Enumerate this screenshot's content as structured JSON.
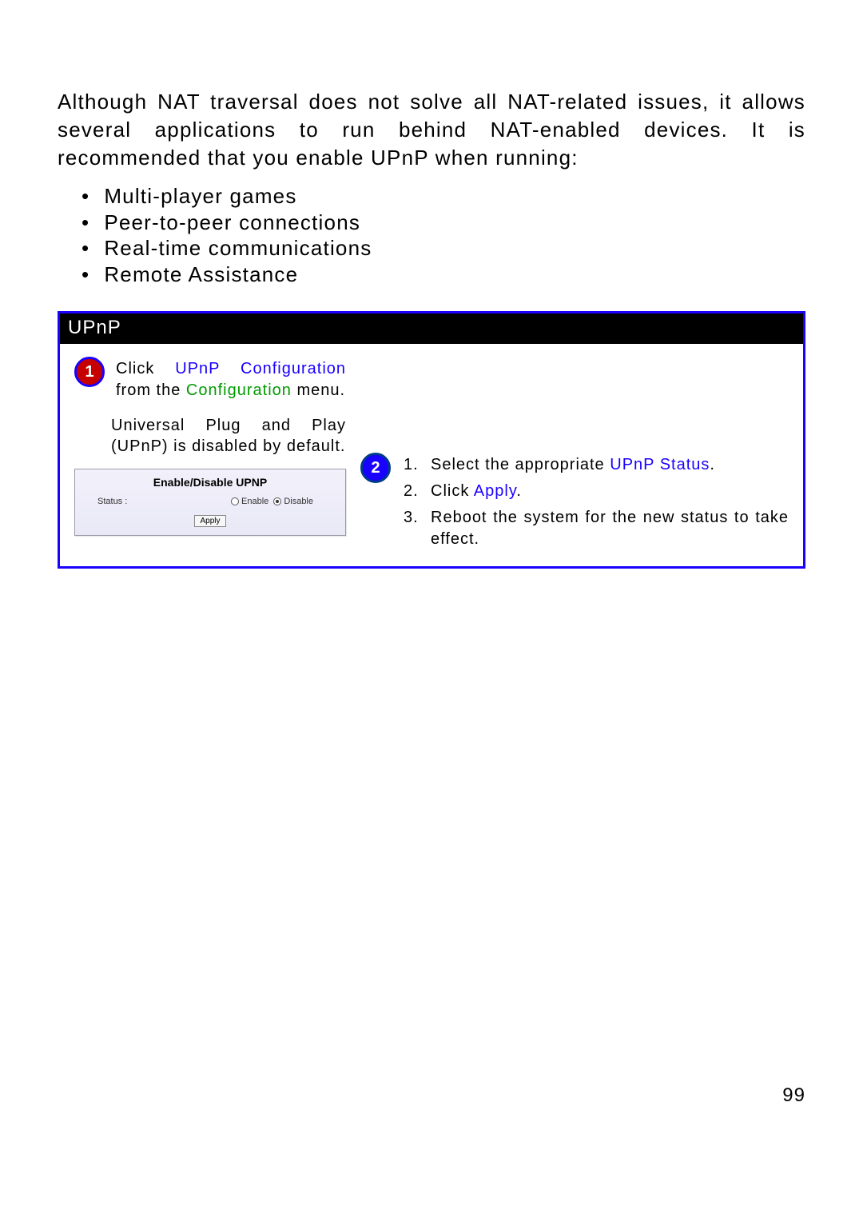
{
  "intro_text": "Although NAT traversal does not solve all NAT-related issues, it allows several applications to run behind NAT-enabled devices. It is recommended that you enable UPnP when running:",
  "bullets": [
    "Multi-player games",
    "Peer-to-peer connections",
    "Real-time communications",
    "Remote Assistance"
  ],
  "panel": {
    "title": "UPnP",
    "step1": {
      "number": "1",
      "pre": "Click ",
      "link": "UPnP Configuration",
      "mid": " from the ",
      "menu": "Configuration",
      "post": " menu."
    },
    "step1_para": "Universal Plug and Play (UPnP) is disabled by default.",
    "widget": {
      "title": "Enable/Disable UPNP",
      "status_label": "Status :",
      "enable_label": "Enable",
      "disable_label": "Disable",
      "apply_label": "Apply",
      "selected": "Disable"
    },
    "step2": {
      "number": "2",
      "items": [
        {
          "n": "1.",
          "pre": "Select the appropriate ",
          "link": "UPnP Status",
          "post": "."
        },
        {
          "n": "2.",
          "pre": "Click ",
          "link": "Apply",
          "post": "."
        },
        {
          "n": "3.",
          "pre": "Reboot the system for the new status to take effect.",
          "link": "",
          "post": ""
        }
      ]
    }
  },
  "page_number": "99"
}
